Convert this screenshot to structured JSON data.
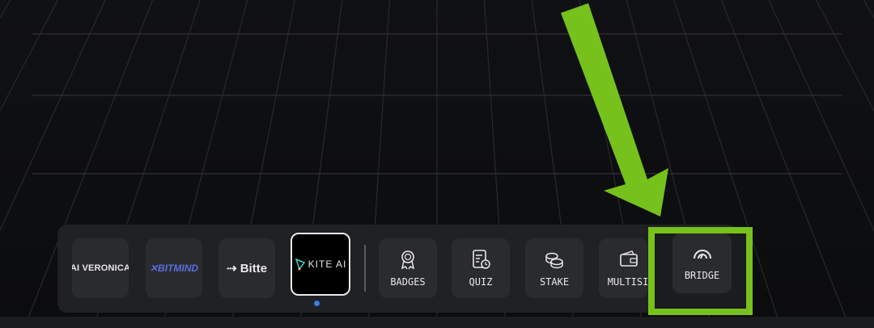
{
  "dock": {
    "partners": [
      {
        "id": "aiveronica",
        "label": "AI VERONICA"
      },
      {
        "id": "bitmind",
        "label": "BITMIND"
      },
      {
        "id": "bitte",
        "label": "Bitte"
      },
      {
        "id": "kite",
        "label": "KITE AI",
        "active": true
      }
    ],
    "actions": [
      {
        "id": "badges",
        "label": "BADGES",
        "icon": "badge-icon"
      },
      {
        "id": "quiz",
        "label": "QUIZ",
        "icon": "quiz-icon"
      },
      {
        "id": "stake",
        "label": "STAKE",
        "icon": "coins-icon"
      },
      {
        "id": "multisig",
        "label": "MULTISI",
        "icon": "wallet-icon"
      },
      {
        "id": "bridge",
        "label": "BRIDGE",
        "icon": "bridge-icon"
      }
    ],
    "active_indicator_color": "#3a7ee8"
  },
  "highlight": {
    "color": "#76c11c",
    "target": "bridge"
  }
}
